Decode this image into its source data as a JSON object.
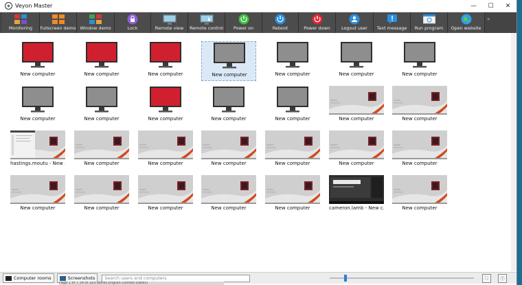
{
  "window": {
    "title": "Veyon Master"
  },
  "colors": {
    "toolbar_bg": "#444444",
    "screen_red": "#d0202f",
    "screen_gray": "#8e8e8e",
    "selection": "#dbe9f7"
  },
  "toolbar": {
    "buttons": [
      {
        "label": "Monitoring",
        "icon": "monitoring-icon"
      },
      {
        "label": "Fullscreen demo",
        "icon": "fullscreen-demo-icon"
      },
      {
        "label": "Window demo",
        "icon": "window-demo-icon"
      },
      {
        "label": "Lock",
        "icon": "lock-icon"
      },
      {
        "label": "Remote view",
        "icon": "remote-view-icon"
      },
      {
        "label": "Remote control",
        "icon": "remote-control-icon"
      },
      {
        "label": "Power on",
        "icon": "power-on-icon"
      },
      {
        "label": "Reboot",
        "icon": "reboot-icon"
      },
      {
        "label": "Power down",
        "icon": "power-down-icon"
      },
      {
        "label": "Logout user",
        "icon": "logout-user-icon"
      },
      {
        "label": "Text message",
        "icon": "text-message-icon"
      },
      {
        "label": "Run program",
        "icon": "run-program-icon"
      },
      {
        "label": "Open website",
        "icon": "open-website-icon"
      }
    ],
    "more": "»"
  },
  "computers": [
    {
      "label": "New computer",
      "state": "locked"
    },
    {
      "label": "New computer",
      "state": "locked"
    },
    {
      "label": "New computer",
      "state": "locked"
    },
    {
      "label": "New computer",
      "state": "offline",
      "selected": true
    },
    {
      "label": "New computer",
      "state": "offline"
    },
    {
      "label": "New computer",
      "state": "offline"
    },
    {
      "label": "New computer",
      "state": "offline"
    },
    {
      "label": "New computer",
      "state": "offline"
    },
    {
      "label": "New computer",
      "state": "offline"
    },
    {
      "label": "New computer",
      "state": "locked"
    },
    {
      "label": "New computer",
      "state": "offline"
    },
    {
      "label": "New computer",
      "state": "offline"
    },
    {
      "label": "New computer",
      "state": "desktop"
    },
    {
      "label": "New computer",
      "state": "desktop"
    },
    {
      "label": "hastings.moutu - New ...",
      "state": "desktop-window"
    },
    {
      "label": "New computer",
      "state": "desktop"
    },
    {
      "label": "New computer",
      "state": "desktop"
    },
    {
      "label": "New computer",
      "state": "desktop"
    },
    {
      "label": "New computer",
      "state": "desktop"
    },
    {
      "label": "New computer",
      "state": "desktop"
    },
    {
      "label": "New computer",
      "state": "desktop"
    },
    {
      "label": "New computer",
      "state": "desktop"
    },
    {
      "label": "New computer",
      "state": "desktop"
    },
    {
      "label": "New computer",
      "state": "desktop"
    },
    {
      "label": "New computer",
      "state": "desktop"
    },
    {
      "label": "New computer",
      "state": "desktop"
    },
    {
      "label": "cameron.lamb - New c...",
      "state": "desktop-dark"
    },
    {
      "label": "New computer",
      "state": "desktop"
    }
  ],
  "statusbar": {
    "computer_rooms": "Computer rooms",
    "screenshots": "Screenshots",
    "search_placeholder": "Search users and computers",
    "zoom_level_fraction": 0.1,
    "icons": [
      "fit-to-window-icon",
      "about-icon"
    ]
  },
  "background_bar_text": "Page 1 of 7     34 of 163 words     English (United States)"
}
